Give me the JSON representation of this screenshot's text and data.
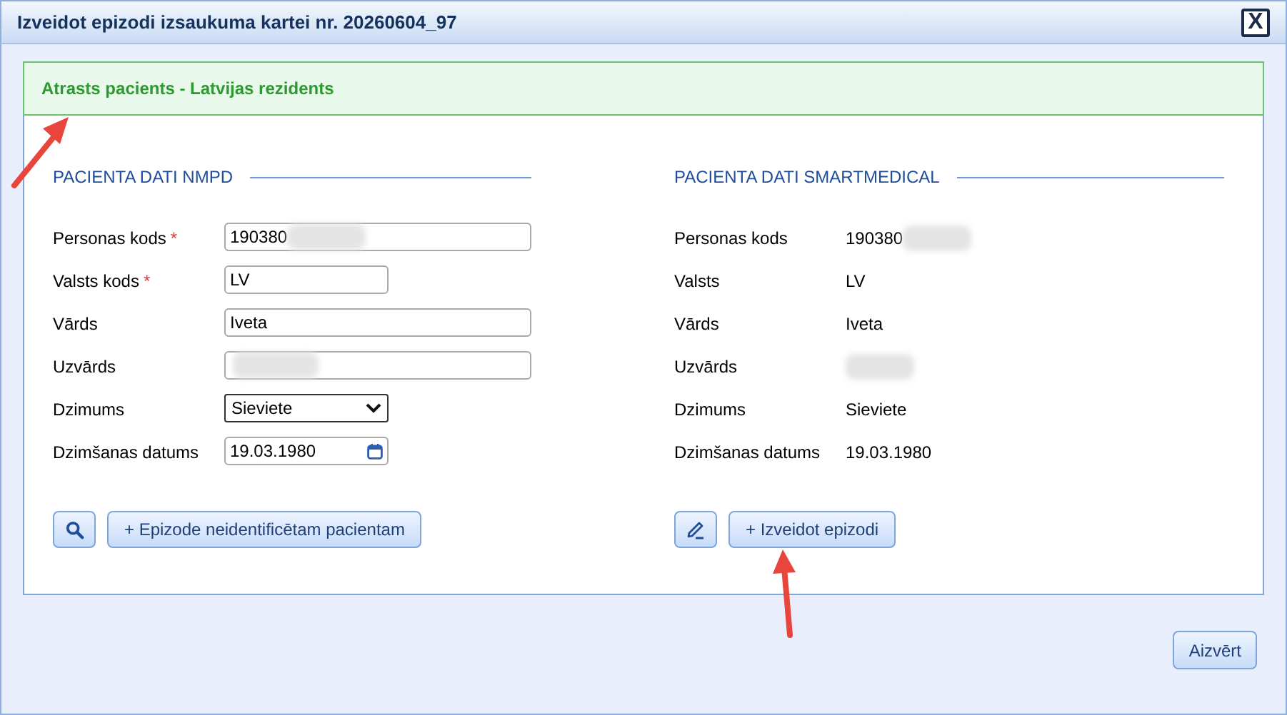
{
  "window": {
    "title": "Izveidot epizodi izsaukuma kartei nr. 20260604_97",
    "close_label": "X"
  },
  "banner": "Atrasts pacients - Latvijas rezidents",
  "left": {
    "heading": "PACIENTA DATI NMPD",
    "fields": [
      {
        "label": "Personas kods",
        "required_mark": "*",
        "kind": "text",
        "value": "190380",
        "blurred": true
      },
      {
        "label": "Valsts kods",
        "required_mark": "*",
        "kind": "code",
        "value": "LV",
        "blurred": false
      },
      {
        "label": "Vārds",
        "kind": "text",
        "value": "Iveta",
        "blurred": false
      },
      {
        "label": "Uzvārds",
        "kind": "text",
        "blurred": true
      },
      {
        "label": "Dzimums",
        "kind": "select",
        "value": "Sieviete",
        "blurred": false
      },
      {
        "label": "Dzimšanas datums",
        "kind": "date",
        "value": "19.03.1980",
        "blurred": false
      }
    ],
    "buttons": [
      {
        "kind": "search"
      },
      {
        "kind": "text",
        "label": "+ Epizode neidentificētam pacientam"
      }
    ]
  },
  "right": {
    "heading": "PACIENTA DATI SMARTMEDICAL",
    "fields": [
      {
        "label": "Personas kods",
        "value": "190380",
        "blurred": true
      },
      {
        "label": "Valsts",
        "value": "LV",
        "blurred": false
      },
      {
        "label": "Vārds",
        "value": "Iveta",
        "blurred": false
      },
      {
        "label": "Uzvārds",
        "blurred": true
      },
      {
        "label": "Dzimums",
        "value": "Sieviete",
        "blurred": false
      },
      {
        "label": "Dzimšanas datums",
        "value": "19.03.1980",
        "blurred": false
      }
    ],
    "buttons": [
      {
        "kind": "edit"
      },
      {
        "kind": "text",
        "label": "+ Izveidot epizodi"
      }
    ]
  },
  "footer_button": "Aizvērt"
}
